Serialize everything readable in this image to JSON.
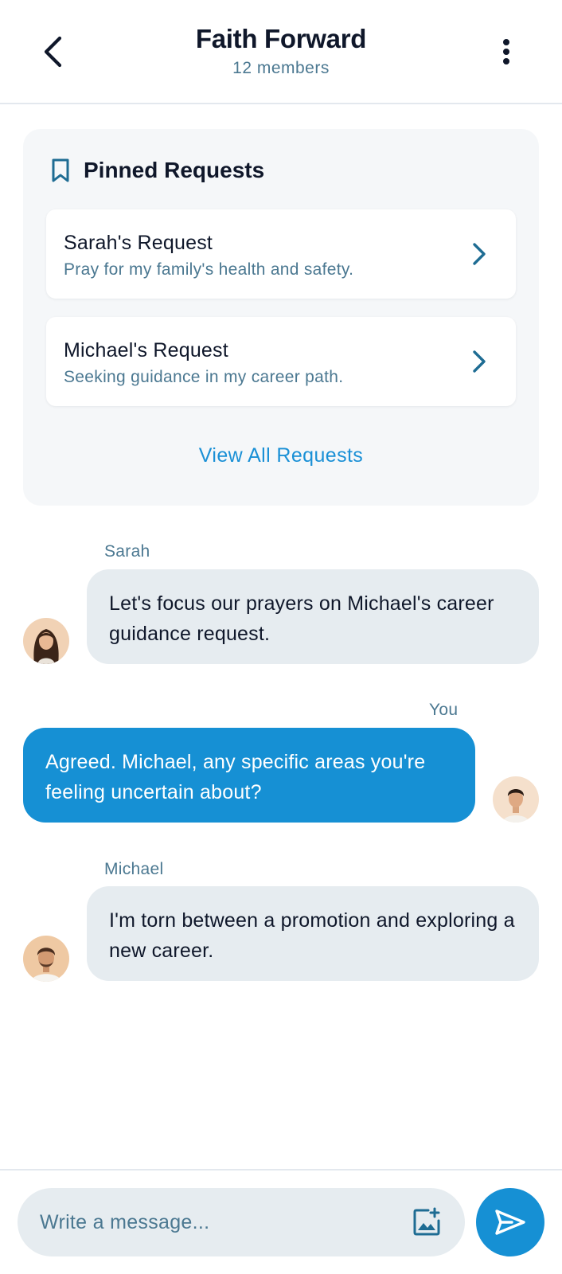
{
  "header": {
    "title": "Faith Forward",
    "subtitle": "12 members",
    "back_icon": "chevron-left-icon",
    "more_icon": "more-vertical-icon"
  },
  "pinned": {
    "title": "Pinned Requests",
    "icon": "bookmark-icon",
    "requests": [
      {
        "title": "Sarah's Request",
        "text": "Pray for my family's health and safety."
      },
      {
        "title": "Michael's Request",
        "text": "Seeking guidance in my career path."
      }
    ],
    "view_all_label": "View All Requests"
  },
  "messages": [
    {
      "sender": "Sarah",
      "text": "Let's focus our prayers on Michael's career guidance request.",
      "direction": "incoming"
    },
    {
      "sender": "You",
      "text": "Agreed. Michael, any specific areas you're feeling uncertain about?",
      "direction": "outgoing"
    },
    {
      "sender": "Michael",
      "text": "I'm torn between a promotion and exploring a new career.",
      "direction": "incoming"
    }
  ],
  "composer": {
    "placeholder": "Write a message...",
    "image_icon": "add-image-icon",
    "send_icon": "send-icon"
  },
  "colors": {
    "accent": "#1690d4",
    "muted_text": "#4b7891",
    "incoming_bubble": "#e6ecf0",
    "card_bg": "#f5f7f9"
  }
}
